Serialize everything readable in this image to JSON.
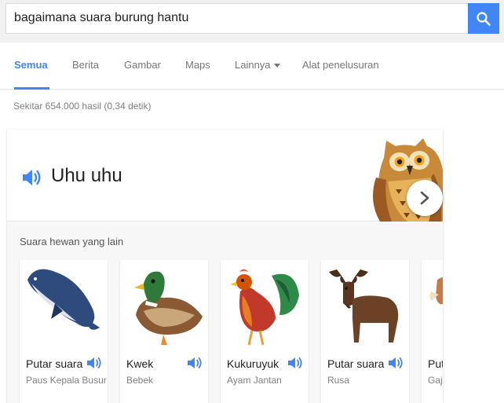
{
  "search": {
    "query": "bagaimana suara burung hantu",
    "button_icon": "search-icon"
  },
  "tabs": [
    {
      "label": "Semua",
      "active": true
    },
    {
      "label": "Berita",
      "active": false
    },
    {
      "label": "Gambar",
      "active": false
    },
    {
      "label": "Maps",
      "active": false
    },
    {
      "label": "Lainnya",
      "active": false
    },
    {
      "label": "Alat penelusuran",
      "active": false
    }
  ],
  "result_stats": "Sekitar 654.000 hasil (0,34 detik)",
  "answer": {
    "sound_text": "Uhu uhu",
    "sound_icon": "speaker-icon",
    "image": "owl-icon"
  },
  "other_sounds": {
    "label": "Suara hewan yang lain",
    "animals": [
      {
        "name": "Putar suara",
        "subtitle": "Paus Kepala Busur",
        "icon": "whale-icon"
      },
      {
        "name": "Kwek",
        "subtitle": "Bebek",
        "icon": "duck-icon"
      },
      {
        "name": "Kukuruyuk",
        "subtitle": "Ayam Jantan",
        "icon": "rooster-icon"
      },
      {
        "name": "Putar suara",
        "subtitle": "Rusa",
        "icon": "moose-icon"
      },
      {
        "name": "Putar suara",
        "subtitle": "Gajah",
        "icon": "elephant-icon"
      }
    ]
  },
  "colors": {
    "accent": "#4285f4",
    "text_muted": "#808080"
  }
}
